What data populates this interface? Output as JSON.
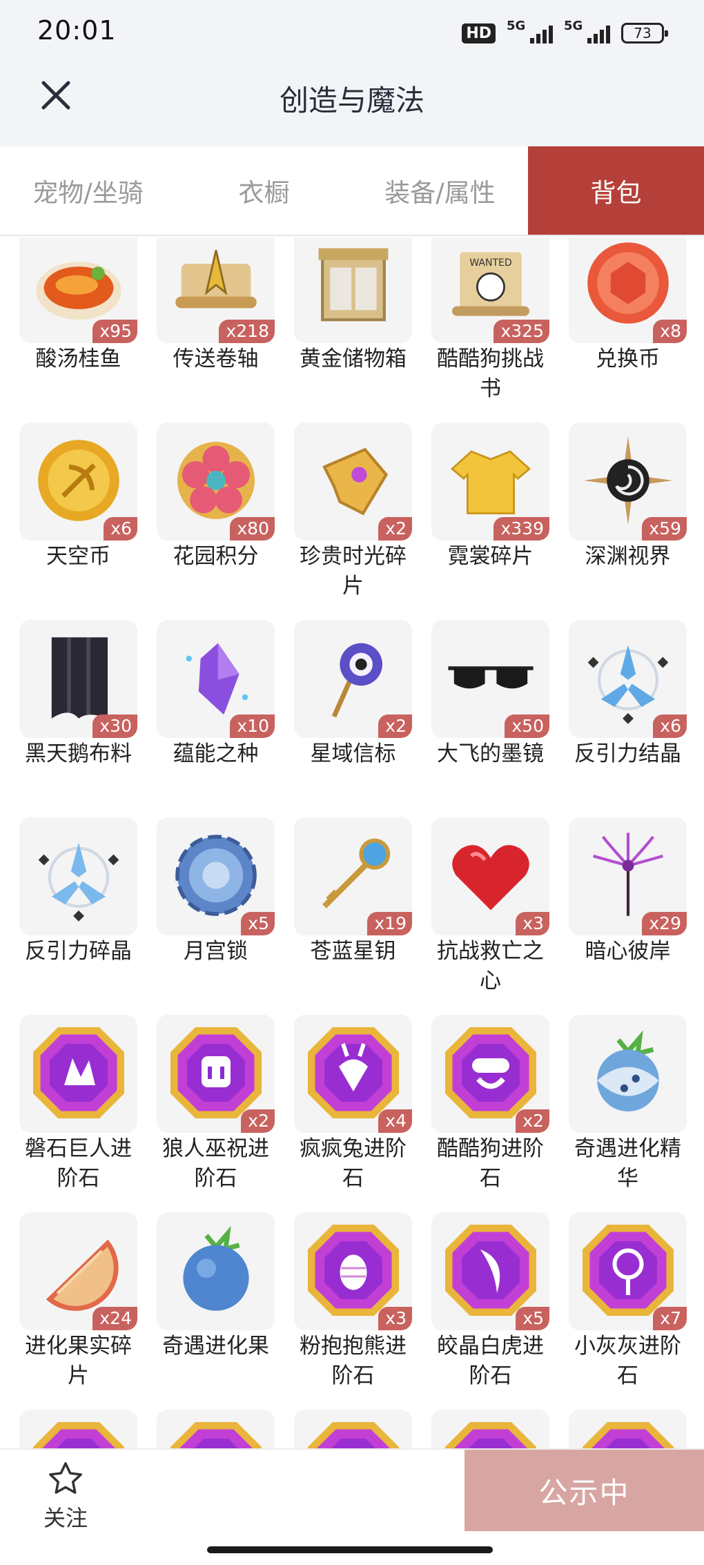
{
  "status": {
    "time": "20:01",
    "hd": "HD",
    "net1": "5G",
    "net2": "5G",
    "battery": "73"
  },
  "header": {
    "title": "创造与魔法"
  },
  "tabs": [
    {
      "label": "宠物/坐骑",
      "active": false
    },
    {
      "label": "衣橱",
      "active": false
    },
    {
      "label": "装备/属性",
      "active": false
    },
    {
      "label": "背包",
      "active": true
    }
  ],
  "items": [
    {
      "name": "酸汤桂鱼",
      "count": "x95",
      "icon": "fish-soup-icon"
    },
    {
      "name": "传送卷轴",
      "count": "x218",
      "icon": "scroll-icon"
    },
    {
      "name": "黄金储物箱",
      "count": "",
      "icon": "gold-chest-icon"
    },
    {
      "name": "酷酷狗挑战书",
      "count": "x325",
      "icon": "wanted-scroll-icon"
    },
    {
      "name": "兑换币",
      "count": "x8",
      "icon": "exchange-coin-icon"
    },
    {
      "name": "天空币",
      "count": "x6",
      "icon": "sky-coin-icon"
    },
    {
      "name": "花园积分",
      "count": "x80",
      "icon": "flower-badge-icon"
    },
    {
      "name": "珍贵时光碎片",
      "count": "x2",
      "icon": "time-fragment-icon"
    },
    {
      "name": "霓裳碎片",
      "count": "x339",
      "icon": "shirt-icon"
    },
    {
      "name": "深渊视界",
      "count": "x59",
      "icon": "abyss-sun-icon"
    },
    {
      "name": "黑天鹅布料",
      "count": "x30",
      "icon": "black-cloth-icon"
    },
    {
      "name": "蕴能之种",
      "count": "x10",
      "icon": "purple-crystal-icon"
    },
    {
      "name": "星域信标",
      "count": "x2",
      "icon": "star-beacon-icon"
    },
    {
      "name": "大飞的墨镜",
      "count": "x50",
      "icon": "sunglasses-icon"
    },
    {
      "name": "反引力结晶",
      "count": "x6",
      "icon": "antigravity-crystal-icon"
    },
    {
      "name": "反引力碎晶",
      "count": "",
      "icon": "antigravity-shard-icon"
    },
    {
      "name": "月宫锁",
      "count": "x5",
      "icon": "moon-lock-icon"
    },
    {
      "name": "苍蓝星钥",
      "count": "x19",
      "icon": "star-key-icon"
    },
    {
      "name": "抗战救亡之心",
      "count": "x3",
      "icon": "heart-icon"
    },
    {
      "name": "暗心彼岸",
      "count": "x29",
      "icon": "spider-lily-icon"
    },
    {
      "name": "磐石巨人进阶石",
      "count": "",
      "icon": "golem-stone-icon"
    },
    {
      "name": "狼人巫祝进阶石",
      "count": "x2",
      "icon": "werewolf-stone-icon"
    },
    {
      "name": "疯疯兔进阶石",
      "count": "x4",
      "icon": "rabbit-stone-icon"
    },
    {
      "name": "酷酷狗进阶石",
      "count": "x2",
      "icon": "dog-stone-icon"
    },
    {
      "name": "奇遇进化精华",
      "count": "",
      "icon": "blue-fruit-essence-icon"
    },
    {
      "name": "进化果实碎片",
      "count": "x24",
      "icon": "fruit-slice-icon"
    },
    {
      "name": "奇遇进化果",
      "count": "",
      "icon": "blue-fruit-icon"
    },
    {
      "name": "粉抱抱熊进阶石",
      "count": "x3",
      "icon": "bear-stone-icon"
    },
    {
      "name": "皎晶白虎进阶石",
      "count": "x5",
      "icon": "tiger-stone-icon"
    },
    {
      "name": "小灰灰进阶石",
      "count": "x7",
      "icon": "lollipop-stone-icon"
    },
    {
      "name": "",
      "count": "",
      "icon": "gem-stone-icon"
    },
    {
      "name": "",
      "count": "",
      "icon": "gem-stone-icon"
    },
    {
      "name": "",
      "count": "",
      "icon": "gem-stone-icon"
    },
    {
      "name": "",
      "count": "",
      "icon": "gem-stone-icon"
    },
    {
      "name": "",
      "count": "",
      "icon": "gem-stone-icon"
    }
  ],
  "footer": {
    "follow_label": "关注",
    "publish_label": "公示中"
  }
}
